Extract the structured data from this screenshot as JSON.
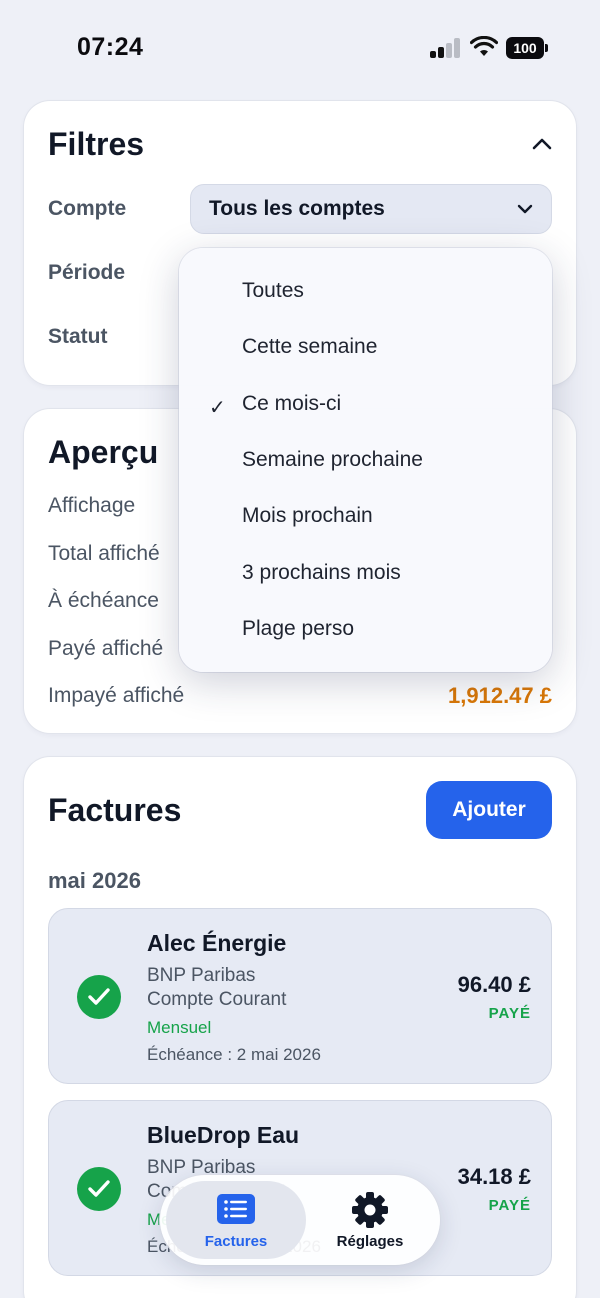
{
  "status_bar": {
    "time": "07:24",
    "battery": "100"
  },
  "filters": {
    "title": "Filtres",
    "account_label": "Compte",
    "account_value": "Tous les comptes",
    "period_label": "Période",
    "status_label": "Statut"
  },
  "period_menu": {
    "items": [
      {
        "label": "Toutes",
        "selected": false
      },
      {
        "label": "Cette semaine",
        "selected": false
      },
      {
        "label": "Ce mois-ci",
        "selected": true
      },
      {
        "label": "Semaine prochaine",
        "selected": false
      },
      {
        "label": "Mois prochain",
        "selected": false
      },
      {
        "label": "3 prochains mois",
        "selected": false
      },
      {
        "label": "Plage perso",
        "selected": false
      }
    ],
    "check_mark": "✓"
  },
  "overview": {
    "title": "Aperçu",
    "rows": [
      {
        "label": "Affichage",
        "value": ""
      },
      {
        "label": "Total affiché",
        "value": ""
      },
      {
        "label": "À échéance",
        "value": ""
      },
      {
        "label": "Payé affiché",
        "value": ""
      },
      {
        "label": "Impayé affiché",
        "value": "1,912.47 £"
      }
    ],
    "unpaid_color": "#d97706"
  },
  "bills": {
    "title": "Factures",
    "add_label": "Ajouter",
    "month": "mai 2026",
    "items": [
      {
        "name": "Alec Énergie",
        "bank": "BNP Paribas",
        "account": "Compte Courant",
        "frequency": "Mensuel",
        "due": "Échéance : 2 mai 2026",
        "amount": "96.40 £",
        "status": "PAYÉ"
      },
      {
        "name": "BlueDrop Eau",
        "bank": "BNP Paribas",
        "account": "Compte Courant",
        "frequency": "Mensuel",
        "due": "Échéance : 2 mai 2026",
        "amount": "34.18 £",
        "status": "PAYÉ"
      }
    ]
  },
  "tabbar": {
    "tabs": [
      {
        "label": "Factures",
        "icon": "list-icon",
        "active": true
      },
      {
        "label": "Réglages",
        "icon": "gear-icon",
        "active": false
      }
    ],
    "accent": "#2563eb"
  }
}
